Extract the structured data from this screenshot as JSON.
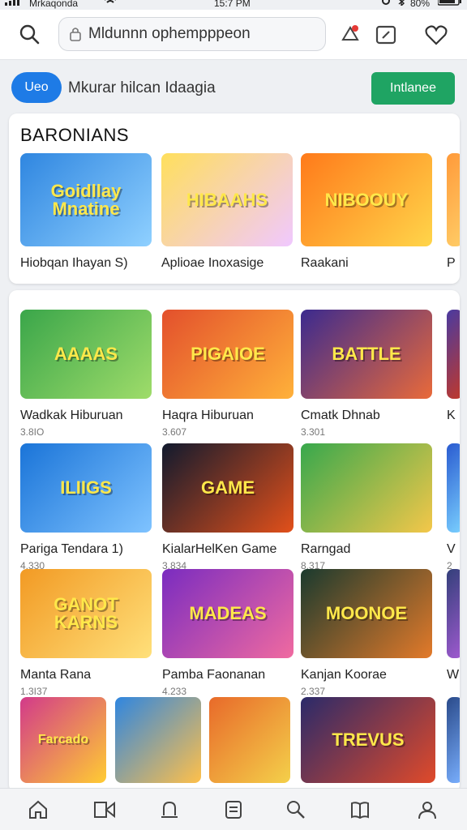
{
  "status_bar": {
    "carrier": "Mrkaqonda",
    "time": "15:7 PM",
    "battery": "80%"
  },
  "search": {
    "placeholder": "Mldunnn ophempppeon"
  },
  "promo": {
    "pill_label": "Ueo",
    "text": "Mkurar hilcan Idaagia",
    "install_label": "Intlanee"
  },
  "featured": {
    "title": "BARONIANS",
    "items": [
      {
        "name": "Hiobqan Ihayan S)",
        "art": "Goidllay Mnatine",
        "colors": [
          "#2f86e0",
          "#8fd0ff"
        ]
      },
      {
        "name": "Aplioae Inoxasige",
        "art": "HIBAAHS",
        "colors": [
          "#ffdf5c",
          "#f0c8ff"
        ]
      },
      {
        "name": "Raakani",
        "art": "NIBOOUY",
        "colors": [
          "#ff7a1a",
          "#ffd54a"
        ]
      },
      {
        "name": "P",
        "art": "",
        "colors": [
          "#ff9a3a",
          "#ffcc66"
        ]
      }
    ]
  },
  "grid": [
    [
      {
        "name": "Wadkak Hiburuan",
        "meta": "3.8IO",
        "art": "AAAAS",
        "colors": [
          "#3aa64a",
          "#9fdc6a"
        ]
      },
      {
        "name": "Haqra Hiburuan",
        "meta": "3.607",
        "art": "PIGAIOE",
        "colors": [
          "#e3502c",
          "#ffb13a"
        ]
      },
      {
        "name": "Cmatk Dhnab",
        "meta": "3.301",
        "art": "BATTLE",
        "colors": [
          "#3b2a8f",
          "#e96a3a"
        ]
      },
      {
        "name": "K",
        "meta": "",
        "art": "",
        "colors": [
          "#4a3aa0",
          "#c0392b"
        ]
      }
    ],
    [
      {
        "name": "Pariga Tendara 1)",
        "meta": "4.330",
        "art": "ILIIGS",
        "colors": [
          "#1a74d8",
          "#7fc3ff"
        ]
      },
      {
        "name": "KialarHelKen Game",
        "meta": "3.834",
        "art": "GAME",
        "colors": [
          "#111a2e",
          "#e2501a"
        ]
      },
      {
        "name": "Rarngad",
        "meta": "8.317",
        "art": "",
        "colors": [
          "#37a84c",
          "#f4c74a"
        ]
      },
      {
        "name": "V",
        "meta": "2",
        "art": "",
        "colors": [
          "#2a5bd0",
          "#7ad0ff"
        ]
      }
    ],
    [
      {
        "name": "Manta Rana",
        "meta": "1.3I37",
        "art": "GANOT KARNS",
        "colors": [
          "#f29a24",
          "#ffe07a"
        ]
      },
      {
        "name": "Pamba Faonanan",
        "meta": "4.233",
        "art": "MADEAS",
        "colors": [
          "#7a2cc0",
          "#f06aa0"
        ]
      },
      {
        "name": "Kanjan Koorae",
        "meta": "2.337",
        "art": "MOONOE",
        "colors": [
          "#1a3a2e",
          "#e37a2a"
        ]
      },
      {
        "name": "W",
        "meta": "",
        "art": "",
        "colors": [
          "#33407a",
          "#a05ad0"
        ]
      }
    ],
    [
      {
        "name": "",
        "meta": "",
        "art": "Farcado",
        "colors": [
          "#d23a8a",
          "#ffcc33"
        ]
      },
      {
        "name": "",
        "meta": "",
        "art": "",
        "colors": [
          "#2f86e0",
          "#ffc04a"
        ]
      },
      {
        "name": "",
        "meta": "",
        "art": "",
        "colors": [
          "#e86a2a",
          "#f4d04a"
        ]
      },
      {
        "name": "",
        "meta": "",
        "art": "TREVUS",
        "colors": [
          "#2a2a6a",
          "#e04a2a"
        ]
      },
      {
        "name": "",
        "meta": "",
        "art": "",
        "colors": [
          "#2a4a8a",
          "#7ab0ff"
        ]
      }
    ]
  ],
  "nav": [
    {
      "icon": "home-icon"
    },
    {
      "icon": "video-icon"
    },
    {
      "icon": "alert-icon"
    },
    {
      "icon": "document-icon"
    },
    {
      "icon": "search-icon"
    },
    {
      "icon": "book-icon"
    },
    {
      "icon": "profile-icon"
    }
  ]
}
